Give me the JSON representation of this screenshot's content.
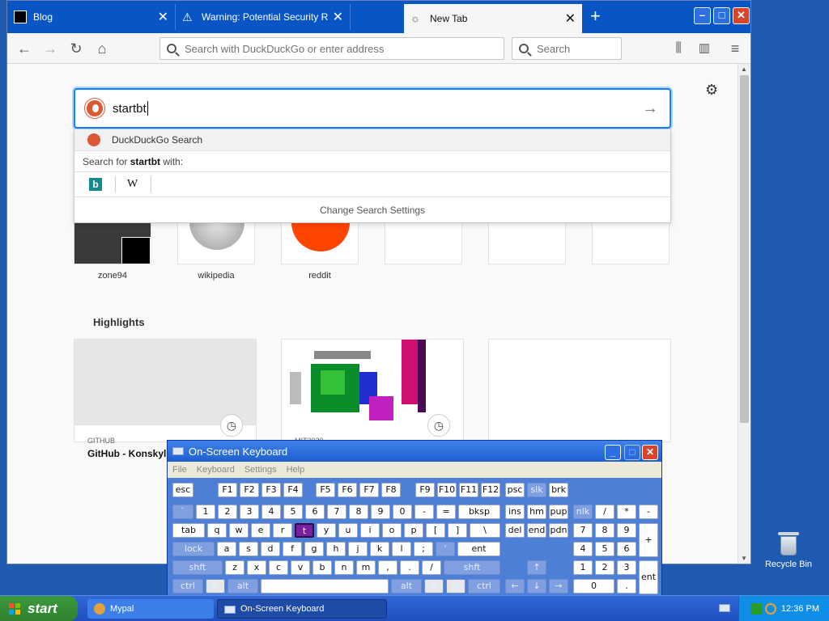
{
  "browser": {
    "tabs": [
      {
        "title": "Blog"
      },
      {
        "title": "Warning: Potential Security Risk Ah"
      },
      {
        "title": "New Tab"
      }
    ],
    "url_placeholder": "Search with DuckDuckGo or enter address",
    "search_placeholder": "Search"
  },
  "newtab": {
    "search_text": "startbt",
    "dropdown": {
      "engine_label": "DuckDuckGo Search",
      "search_for_prefix": "Search for ",
      "search_for_term": "startbt",
      "search_for_suffix": " with:",
      "wiki_glyph": "W",
      "bing_glyph": "b",
      "change_settings": "Change Search Settings"
    },
    "top_sites": [
      {
        "label": "zone94"
      },
      {
        "label": "wikipedia"
      },
      {
        "label": "reddit"
      }
    ],
    "highlights_title": "Highlights",
    "highlights": [
      {
        "source": "GITHUB",
        "title": "GitHub - Konskylu"
      },
      {
        "source": "MIT2020",
        "title": ""
      }
    ]
  },
  "osk": {
    "title": "On-Screen Keyboard",
    "menu": [
      "File",
      "Keyboard",
      "Settings",
      "Help"
    ]
  },
  "desktop": {
    "recycle_label": "Recycle Bin"
  },
  "taskbar": {
    "start": "start",
    "tasks": [
      "Mypal",
      "On-Screen Keyboard"
    ],
    "time": "12:36 PM"
  }
}
